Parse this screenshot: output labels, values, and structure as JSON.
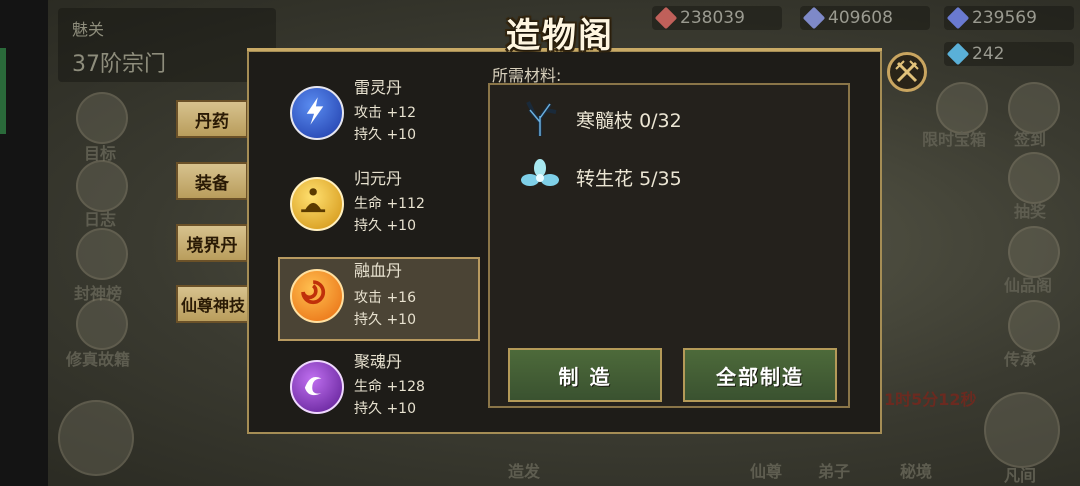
{
  "background": {
    "realm_label": "魅关",
    "realm_value": "37阶宗门",
    "resources": [
      {
        "value": "238039",
        "color": "#c0605a"
      },
      {
        "value": "409608",
        "color": "#7e89c8"
      },
      {
        "value": "239569",
        "color": "#6a7ad0"
      },
      {
        "value": "242",
        "color": "#5ab0d8"
      }
    ],
    "side_labels": [
      "目标",
      "日志",
      "封神榜",
      "修真故籍",
      "限时宝箱",
      "签到",
      "抽奖",
      "仙品阁",
      "传承",
      "造发",
      "仙尊",
      "弟子",
      "秘境",
      "凡间"
    ],
    "timer_text": "1时5分12秒"
  },
  "modal": {
    "title": "造物阁",
    "close_icon": "crossed-swords-close-icon"
  },
  "categories": [
    {
      "label": "丹药"
    },
    {
      "label": "装备"
    },
    {
      "label": "境界丹"
    },
    {
      "label": "仙尊神技"
    }
  ],
  "items": [
    {
      "name": "雷灵丹",
      "stat1": "攻击 +12",
      "stat2": "持久 +10",
      "orb_color": "#2f5bd6",
      "icon": "lightning-orb-icon",
      "selected": false
    },
    {
      "name": "归元丹",
      "stat1": "生命 +112",
      "stat2": "持久 +10",
      "orb_color": "#e8b020",
      "icon": "meditation-orb-icon",
      "selected": false
    },
    {
      "name": "融血丹",
      "stat1": "攻击 +16",
      "stat2": "持久 +10",
      "orb_color": "#f08a18",
      "icon": "swirl-orb-icon",
      "selected": true
    },
    {
      "name": "聚魂丹",
      "stat1": "生命 +128",
      "stat2": "持久 +10",
      "orb_color": "#8a2fc0",
      "icon": "soul-orb-icon",
      "selected": false
    }
  ],
  "materials": {
    "header": "所需材料:",
    "list": [
      {
        "name": "寒髓枝",
        "count": "0/32",
        "icon": "frost-branch-icon"
      },
      {
        "name": "转生花",
        "count": "5/35",
        "icon": "rebirth-flower-icon"
      }
    ]
  },
  "buttons": {
    "craft": "制 造",
    "craft_all": "全部制造"
  }
}
